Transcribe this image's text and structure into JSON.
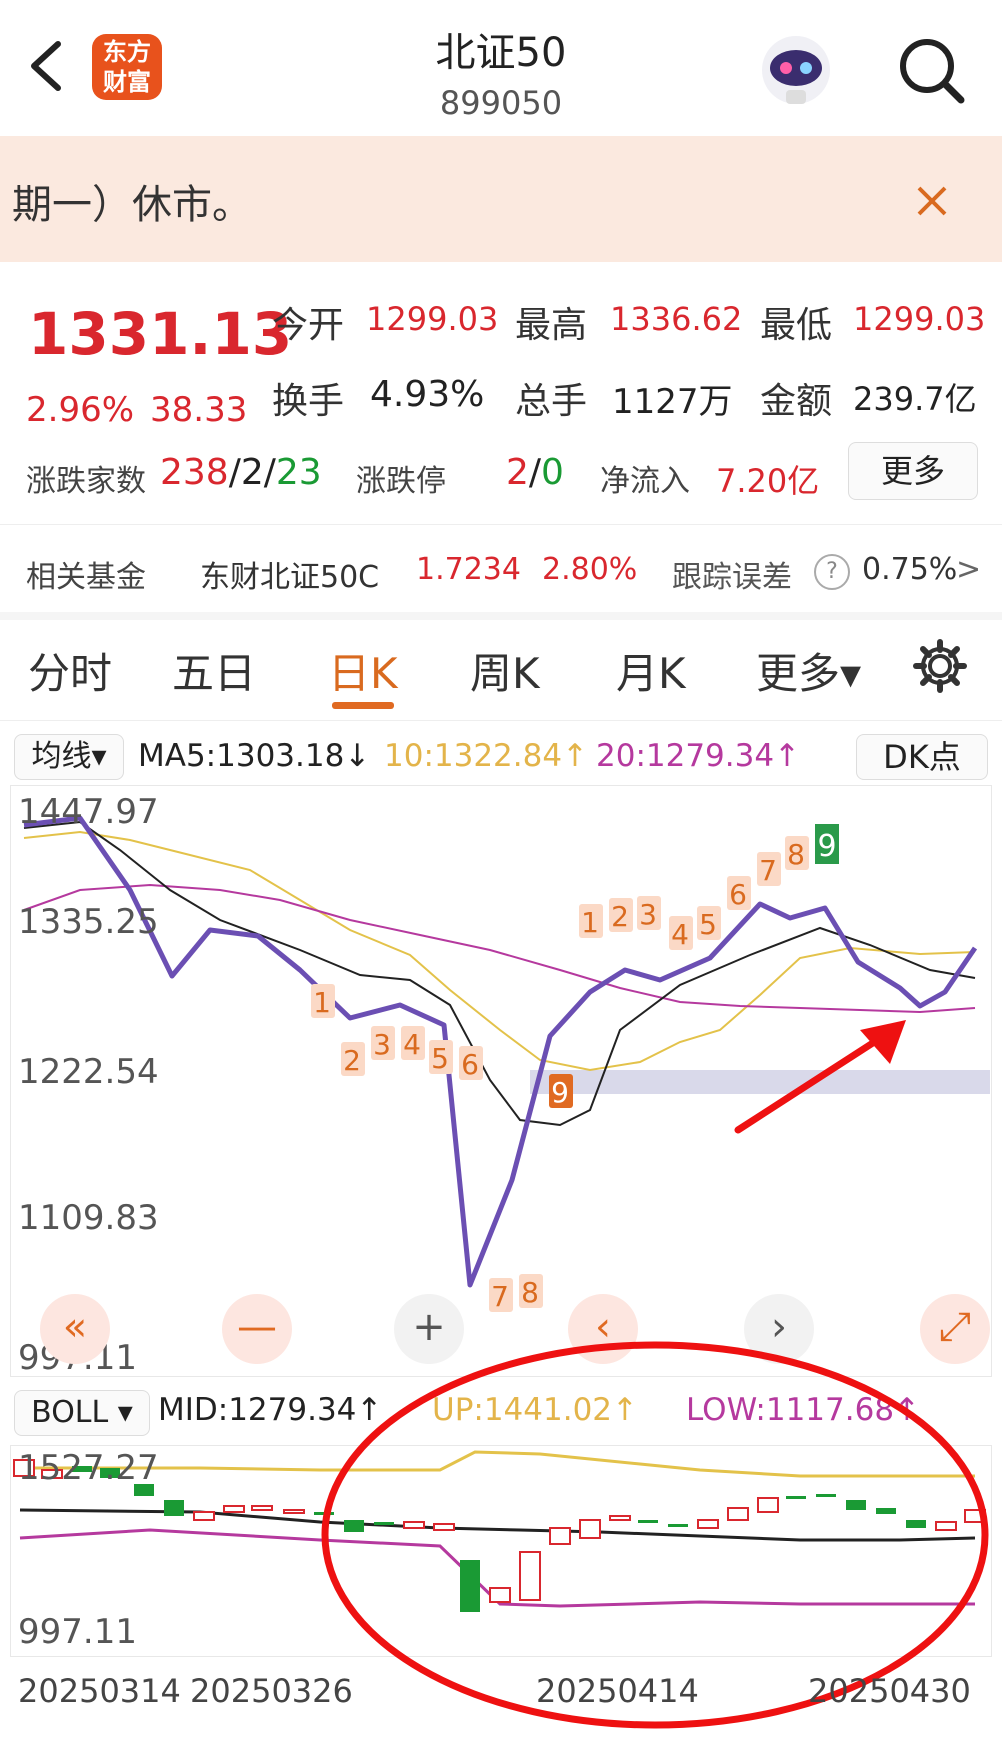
{
  "header": {
    "title": "北证50",
    "code": "899050",
    "logo_text_line1": "东方",
    "logo_text_line2": "财富",
    "back_icon": "chevron-left-icon",
    "search_icon": "search-icon",
    "assistant_icon": "robot-avatar-icon"
  },
  "notice": {
    "text": "期一）休市。",
    "close_icon": "close-icon"
  },
  "quote": {
    "price": "1331.13",
    "change_pct": "2.96%",
    "change_val": "38.33",
    "open_label": "今开",
    "open_val": "1299.03",
    "high_label": "最高",
    "high_val": "1336.62",
    "low_label": "最低",
    "low_val": "1299.03",
    "turnover_label": "换手",
    "turnover_val": "4.93%",
    "volume_label": "总手",
    "volume_val": "1127万",
    "amount_label": "金额",
    "amount_val": "239.7亿",
    "breadth_label": "涨跌家数",
    "breadth_up": "238",
    "breadth_slash1": "/",
    "breadth_flat": "2",
    "breadth_slash2": "/",
    "breadth_down": "23",
    "limit_label": "涨跌停",
    "limit_up": "2",
    "limit_slash": "/",
    "limit_down": "0",
    "inflow_label": "净流入",
    "inflow_val": "7.20亿",
    "more_button": "更多"
  },
  "fund": {
    "label": "相关基金",
    "name": "东财北证50C",
    "nav": "1.7234",
    "pct": "2.80%",
    "err_label": "跟踪误差",
    "err_help": "?",
    "err_val": "0.75%",
    "arrow": ">"
  },
  "tabs": [
    {
      "label": "分时"
    },
    {
      "label": "五日"
    },
    {
      "label": "日K"
    },
    {
      "label": "周K"
    },
    {
      "label": "月K"
    },
    {
      "label": "更多▾"
    }
  ],
  "ma_legend": {
    "selector": "均线▾",
    "ma5": "MA5:1303.18↓",
    "ma10": "10:1322.84↑",
    "ma20": "20:1279.34↑",
    "dk_button": "DK点"
  },
  "main_axis": [
    "1447.97",
    "1335.25",
    "1222.54",
    "1109.83",
    "997.11"
  ],
  "td_seq_top": [
    "1",
    "2",
    "3",
    "4",
    "5",
    "6",
    "7",
    "8",
    "9"
  ],
  "td_seq_bottom": [
    "1",
    "2",
    "3",
    "4",
    "5",
    "6",
    "7",
    "8",
    "9"
  ],
  "controls": {
    "rewind": "«",
    "zoom_out": "—",
    "zoom_in": "+",
    "prev": "‹",
    "next": "›",
    "expand": "⤢"
  },
  "boll_legend": {
    "selector": "BOLL ▾",
    "mid": "MID:1279.34↑",
    "up": "UP:1441.02↑",
    "low": "LOW:1117.68↑"
  },
  "boll_axis": [
    "1527.27",
    "997.11"
  ],
  "dates": [
    "20250314",
    "20250326",
    "20250414",
    "20250430"
  ],
  "colors": {
    "red": "#d9272e",
    "green": "#1a9a34",
    "orange": "#e06a22",
    "purple": "#6b4fb3",
    "yellow": "#e3c24a",
    "magenta": "#b5399e"
  }
}
